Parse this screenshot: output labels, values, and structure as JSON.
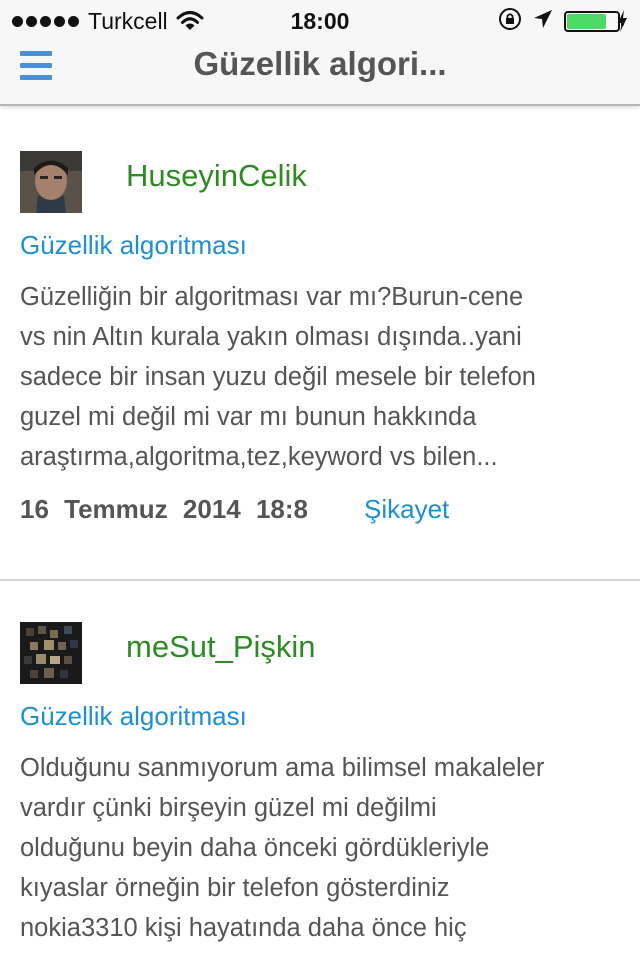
{
  "status_bar": {
    "carrier": "Turkcell",
    "time": "18:00",
    "battery_level": 0.78,
    "icons": [
      "signal-dots-icon",
      "wifi-icon",
      "orientation-lock-icon",
      "location-arrow-icon",
      "battery-icon",
      "charging-bolt-icon"
    ]
  },
  "nav": {
    "title": "Güzellik algori...",
    "menu_icon": "hamburger-menu-icon",
    "accent": "#4a90d9"
  },
  "colors": {
    "username": "#2e8b24",
    "link": "#1f8fd0",
    "body_text": "#555555"
  },
  "posts": [
    {
      "username": "HuseyinCelik",
      "title": "Güzellik algoritması",
      "body_lines": [
        "Güzelliğin bir algoritması var mı?Burun-cene",
        "vs nin Altın kurala yakın olması dışında..yani",
        "sadece bir insan yuzu değil mesele bir telefon",
        "guzel mi değil mi var mı bunun hakkında",
        "araştırma,algoritma,tez,keyword vs bilen..."
      ],
      "date": "16 Temmuz 2014 18:8",
      "report_label": "Şikayet"
    },
    {
      "username": "meSut_Pişkin",
      "title": "Güzellik algoritması",
      "body_lines": [
        "Olduğunu sanmıyorum ama bilimsel makaleler",
        "vardır çünki birşeyin güzel mi değilmi",
        "olduğunu beyin daha önceki gördükleriyle",
        "kıyaslar örneğin bir telefon gösterdiniz",
        "nokia3310 kişi hayatında daha önce hiç"
      ]
    }
  ]
}
